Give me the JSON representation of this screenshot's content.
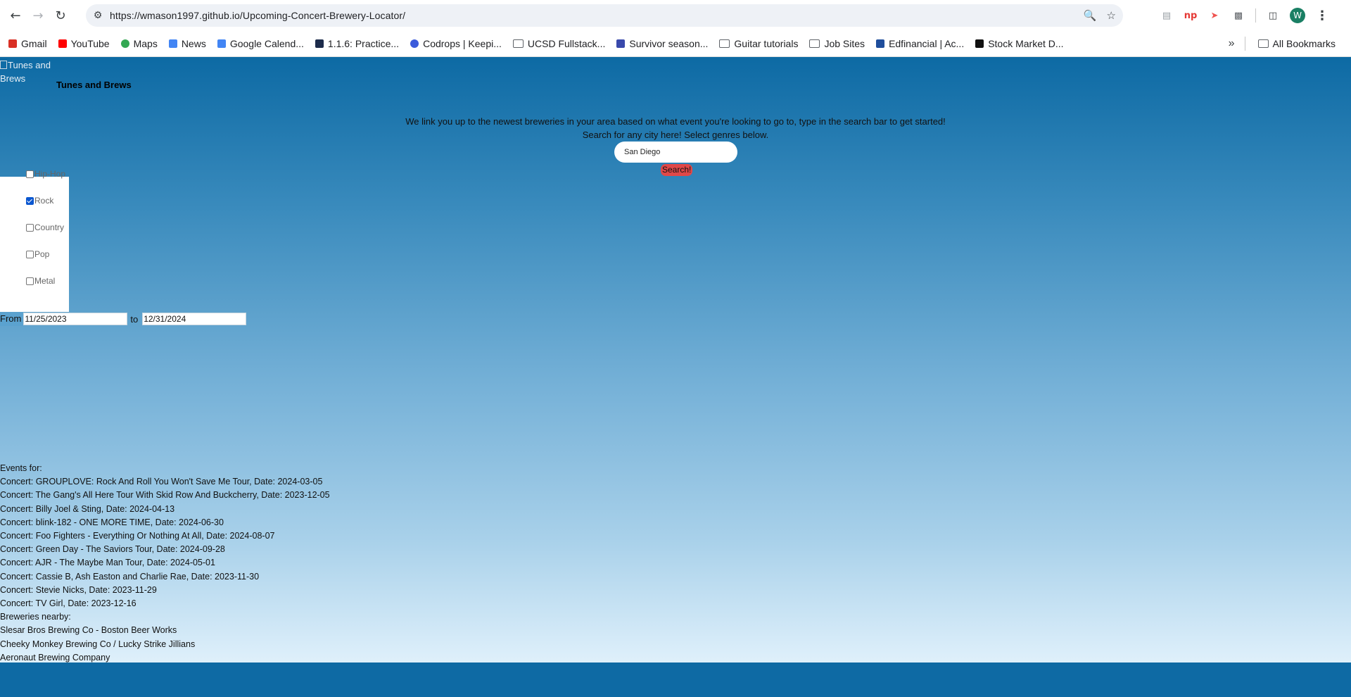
{
  "browser": {
    "url": "https://wmason1997.github.io/Upcoming-Concert-Brewery-Locator/",
    "profile_initial": "W",
    "bookmarks": [
      {
        "label": "Gmail",
        "icon": "gmail-icon",
        "color": "#d93025"
      },
      {
        "label": "YouTube",
        "icon": "youtube-icon",
        "color": "#ff0000"
      },
      {
        "label": "Maps",
        "icon": "maps-icon",
        "color": "#34a853"
      },
      {
        "label": "News",
        "icon": "news-icon",
        "color": "#4285f4"
      },
      {
        "label": "Google Calend...",
        "icon": "calendar-icon",
        "color": "#4285f4"
      },
      {
        "label": "1.1.6: Practice...",
        "icon": "edx-icon",
        "color": "#1c2b4b"
      },
      {
        "label": "Codrops | Keepi...",
        "icon": "codrops-icon",
        "color": "#3b5bdb"
      },
      {
        "label": "UCSD Fullstack...",
        "icon": "folder-icon",
        "color": "#5f6368"
      },
      {
        "label": "Survivor season...",
        "icon": "sheet-icon",
        "color": "#3949ab"
      },
      {
        "label": "Guitar tutorials",
        "icon": "folder-icon",
        "color": "#5f6368"
      },
      {
        "label": "Job Sites",
        "icon": "folder-icon",
        "color": "#5f6368"
      },
      {
        "label": "Edfinancial | Ac...",
        "icon": "edfinancial-icon",
        "color": "#1f4e9c"
      },
      {
        "label": "Stock Market D...",
        "icon": "stock-icon",
        "color": "#111111"
      }
    ],
    "all_bookmarks": "All Bookmarks"
  },
  "page": {
    "logo_alt": "Tunes and Brews",
    "title": "Tunes and Brews",
    "intro_line1": "We link you up to the newest breweries in your area based on what event you're looking to go to, type in the search bar to get started!",
    "intro_line2": "Search for any city here! Select genres below.",
    "search_value": "San Diego",
    "search_button": "Search!",
    "genres": [
      {
        "label": "Hip-Hop",
        "checked": false
      },
      {
        "label": "Rock",
        "checked": true
      },
      {
        "label": "Country",
        "checked": false
      },
      {
        "label": "Pop",
        "checked": false
      },
      {
        "label": "Metal",
        "checked": false
      }
    ],
    "date_from_label": "From",
    "date_from": "11/25/2023",
    "date_to_label": "to",
    "date_to": "12/31/2024",
    "events_header": "Events for:",
    "events": [
      "Concert: GROUPLOVE: Rock And Roll You Won't Save Me Tour, Date: 2024-03-05",
      "Concert: The Gang's All Here Tour With Skid Row And Buckcherry, Date: 2023-12-05",
      "Concert: Billy Joel & Sting, Date: 2024-04-13",
      "Concert: blink-182 - ONE MORE TIME, Date: 2024-06-30",
      "Concert: Foo Fighters - Everything Or Nothing At All, Date: 2024-08-07",
      "Concert: Green Day - The Saviors Tour, Date: 2024-09-28",
      "Concert: AJR - The Maybe Man Tour, Date: 2024-05-01",
      "Concert: Cassie B, Ash Easton and Charlie Rae, Date: 2023-11-30",
      "Concert: Stevie Nicks, Date: 2023-11-29",
      "Concert: TV Girl, Date: 2023-12-16"
    ],
    "breweries_header": "Breweries nearby:",
    "breweries": [
      "Slesar Bros Brewing Co - Boston Beer Works",
      "Cheeky Monkey Brewing Co / Lucky Strike Jillians",
      "Aeronaut Brewing Company"
    ]
  }
}
